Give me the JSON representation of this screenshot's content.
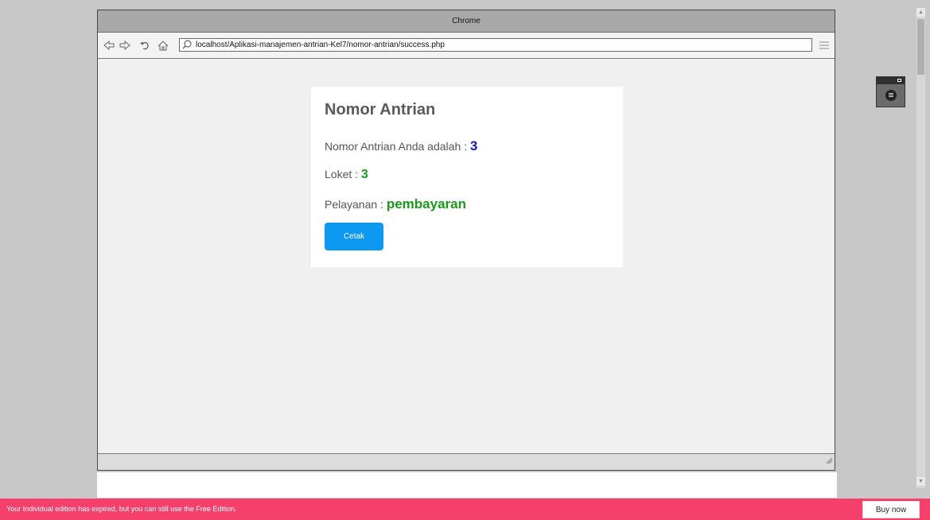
{
  "window": {
    "title": "Chrome"
  },
  "address_bar": {
    "url": "localhost/Aplikasi-manajemen-antrian-Kel7/nomor-antrian/success.php"
  },
  "icons": {
    "back": "back-arrow-icon",
    "forward": "forward-arrow-icon",
    "reload": "reload-icon",
    "home": "home-icon",
    "search": "search-icon",
    "menu": "hamburger-menu-icon"
  },
  "card": {
    "title": "Nomor Antrian",
    "queue_label": "Nomor Antrian Anda adalah : ",
    "queue_value": "3",
    "counter_label": "Loket : ",
    "counter_value": "3",
    "service_label": "Pelayanan : ",
    "service_value": "pembayaran",
    "print_button": "Cetak"
  },
  "banner": {
    "message": "Your Individual edition has expired, but you can still use the Free Edition.",
    "buy_label": "Buy now"
  },
  "colors": {
    "accent_blue": "#0d99f2",
    "value_blue": "#1a1ab8",
    "value_green": "#1a9a1a",
    "banner": "#f4406b"
  }
}
